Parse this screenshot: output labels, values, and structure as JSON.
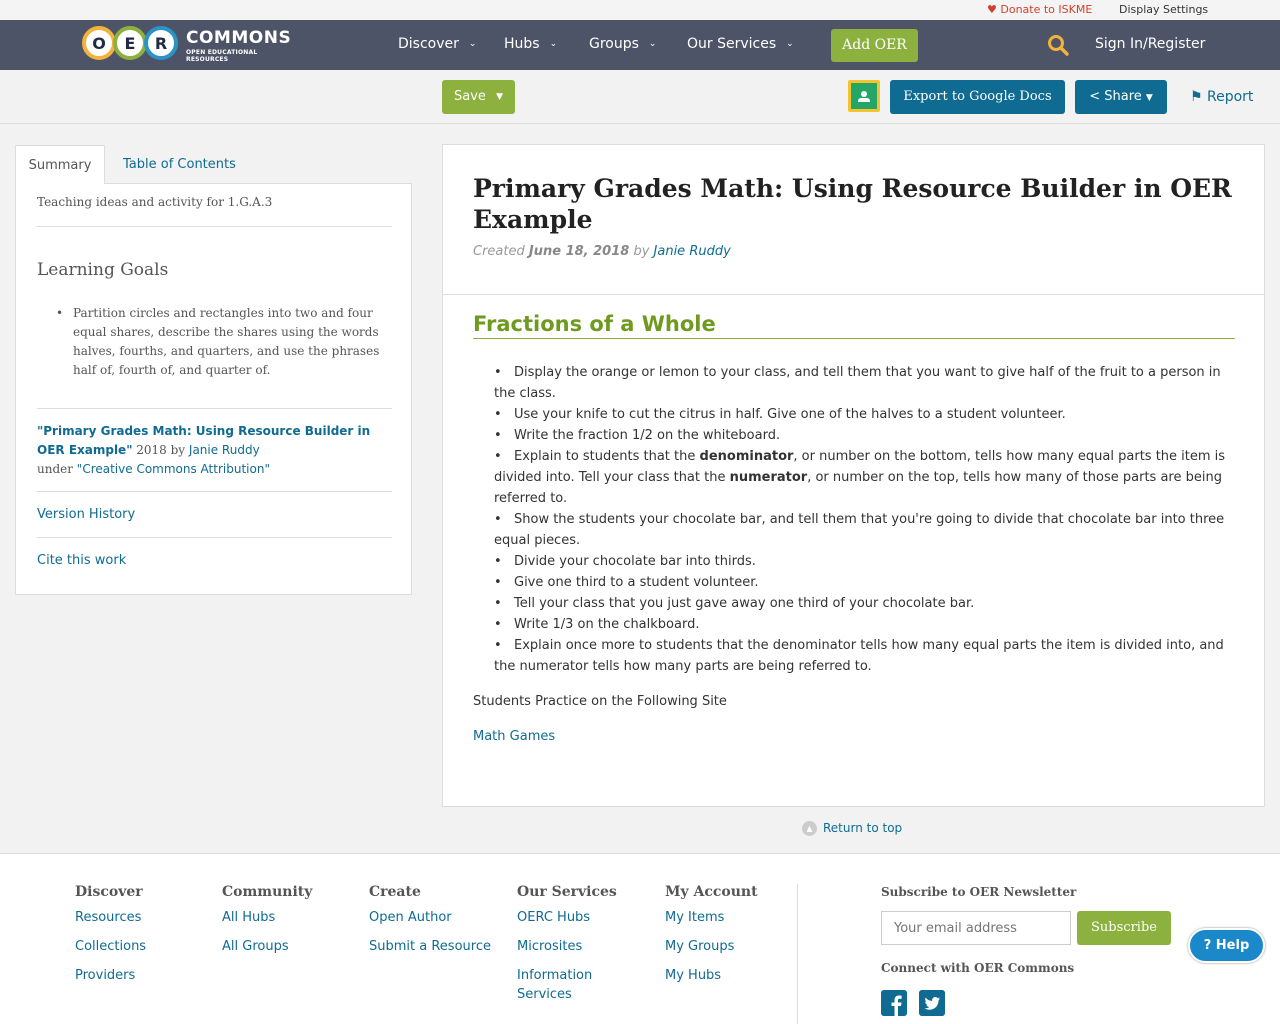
{
  "util": {
    "donate": "Donate to ISKME",
    "display_settings": "Display Settings"
  },
  "nav": {
    "logo_letters": [
      "O",
      "E",
      "R"
    ],
    "logo_word": "COMMONS",
    "logo_sub": "OPEN EDUCATIONAL RESOURCES",
    "items": [
      "Discover",
      "Hubs",
      "Groups",
      "Our Services"
    ],
    "add_oer": "Add OER",
    "sign_in": "Sign In/Register"
  },
  "toolbar": {
    "save": "Save",
    "export": "Export to Google Docs",
    "share": "Share",
    "report": "Report"
  },
  "tabs": {
    "summary": "Summary",
    "toc": "Table of Contents"
  },
  "left": {
    "summary_text": "Teaching ideas and activity for 1.G.A.3",
    "goals_title": "Learning Goals",
    "goal": "Partition circles and rectangles into two and four equal shares, describe the shares using the words halves, fourths, and quarters, and use the phrases half of, fourth of, and quarter of.",
    "cite_title": "\"Primary Grades Math: Using Resource Builder in OER Example\"",
    "cite_year_by": " 2018 by ",
    "cite_author": "Janie Ruddy",
    "cite_under": "under ",
    "cite_license": "\"Creative Commons Attribution\"",
    "version_history": "Version History",
    "cite_work": "Cite this work"
  },
  "main": {
    "title": "Primary Grades Math: Using Resource Builder in OER Example",
    "created_label": "Created ",
    "created_date": "June 18, 2018",
    "by": " by ",
    "author": "Janie Ruddy",
    "section_title": "Fractions of a Whole",
    "steps": [
      "Display the orange or lemon to your class, and tell them that you want to give half of the fruit to a person in the class.",
      "Use your knife to cut the citrus in half. Give one of the halves to a student volunteer.",
      "Write the fraction 1/2 on the whiteboard.",
      "Show the students your chocolate bar, and tell them that you're going to divide that chocolate bar into three equal pieces.",
      "Divide your chocolate bar into thirds.",
      "Give one third to a student volunteer.",
      "Tell your class that you just gave away one third of your chocolate bar.",
      "Write 1/3 on the chalkboard.",
      "Explain once more to students that the denominator tells how many equal parts the item is divided into, and the numerator tells how many parts are being referred to."
    ],
    "explain_step": {
      "a": "Explain to students that the ",
      "b": "denominator",
      "c": ", or number on the bottom, tells how many equal parts the item is divided into. Tell your class that the ",
      "d": "numerator",
      "e": ", or number on the top, tells how many of those parts are being referred to."
    },
    "practice": "Students Practice on the Following Site",
    "math_games": "Math Games"
  },
  "return_top": "Return to top",
  "footer": {
    "discover": {
      "title": "Discover",
      "links": [
        "Resources",
        "Collections",
        "Providers"
      ]
    },
    "community": {
      "title": "Community",
      "links": [
        "All Hubs",
        "All Groups"
      ]
    },
    "create": {
      "title": "Create",
      "links": [
        "Open Author",
        "Submit a Resource"
      ]
    },
    "services": {
      "title": "Our Services",
      "links": [
        "OERC Hubs",
        "Microsites",
        "Information Services"
      ]
    },
    "account": {
      "title": "My Account",
      "links": [
        "My Items",
        "My Groups",
        "My Hubs"
      ]
    },
    "newsletter_title": "Subscribe to OER Newsletter",
    "email_placeholder": "Your email address",
    "subscribe": "Subscribe",
    "connect": "Connect with OER Commons"
  },
  "help": "Help",
  "colors": {
    "nav_bg": "#4d5467",
    "accent_green": "#8cb13e",
    "link_blue": "#0f6b91",
    "donate_red": "#d0402c"
  }
}
